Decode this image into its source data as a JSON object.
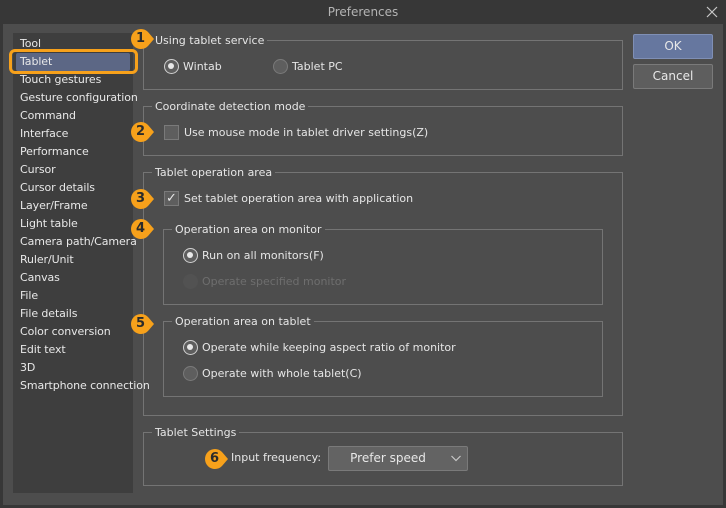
{
  "window": {
    "title": "Preferences",
    "close_icon": "close-icon"
  },
  "sidebar": {
    "selected_index": 1,
    "items": [
      {
        "label": "Tool"
      },
      {
        "label": "Tablet"
      },
      {
        "label": "Touch gestures"
      },
      {
        "label": "Gesture configuration"
      },
      {
        "label": "Command"
      },
      {
        "label": "Interface"
      },
      {
        "label": "Performance"
      },
      {
        "label": "Cursor"
      },
      {
        "label": "Cursor details"
      },
      {
        "label": "Layer/Frame"
      },
      {
        "label": "Light table"
      },
      {
        "label": "Camera path/Camera"
      },
      {
        "label": "Ruler/Unit"
      },
      {
        "label": "Canvas"
      },
      {
        "label": "File"
      },
      {
        "label": "File details"
      },
      {
        "label": "Color conversion"
      },
      {
        "label": "Edit text"
      },
      {
        "label": "3D"
      },
      {
        "label": "Smartphone connection"
      }
    ]
  },
  "buttons": {
    "ok": "OK",
    "cancel": "Cancel"
  },
  "tablet_service": {
    "title": "Using tablet service",
    "options": [
      {
        "label": "Wintab",
        "checked": true
      },
      {
        "label": "Tablet PC",
        "checked": false
      }
    ]
  },
  "coordinate_mode": {
    "title": "Coordinate detection mode",
    "checkbox_label": "Use mouse mode in tablet driver settings(Z)",
    "checked": false
  },
  "operation_area": {
    "title": "Tablet operation area",
    "checkbox_label": "Set tablet operation area with application",
    "checked": true,
    "monitor": {
      "title": "Operation area on monitor",
      "options": [
        {
          "label": "Run on all monitors(F)",
          "checked": true,
          "disabled": false
        },
        {
          "label": "Operate specified monitor",
          "checked": false,
          "disabled": true
        }
      ]
    },
    "tablet": {
      "title": "Operation area on tablet",
      "options": [
        {
          "label": "Operate while keeping aspect ratio of monitor",
          "checked": true
        },
        {
          "label": "Operate with whole tablet(C)",
          "checked": false
        }
      ]
    }
  },
  "tablet_settings": {
    "title": "Tablet Settings",
    "input_frequency_label": "Input frequency:",
    "input_frequency_value": "Prefer speed"
  },
  "badges": [
    "1",
    "2",
    "3",
    "4",
    "5",
    "6"
  ],
  "colors": {
    "badge": "#f7a11b",
    "highlight": "#f7a11b",
    "selected_item": "#5c6785",
    "ok_button": "#66779f"
  }
}
